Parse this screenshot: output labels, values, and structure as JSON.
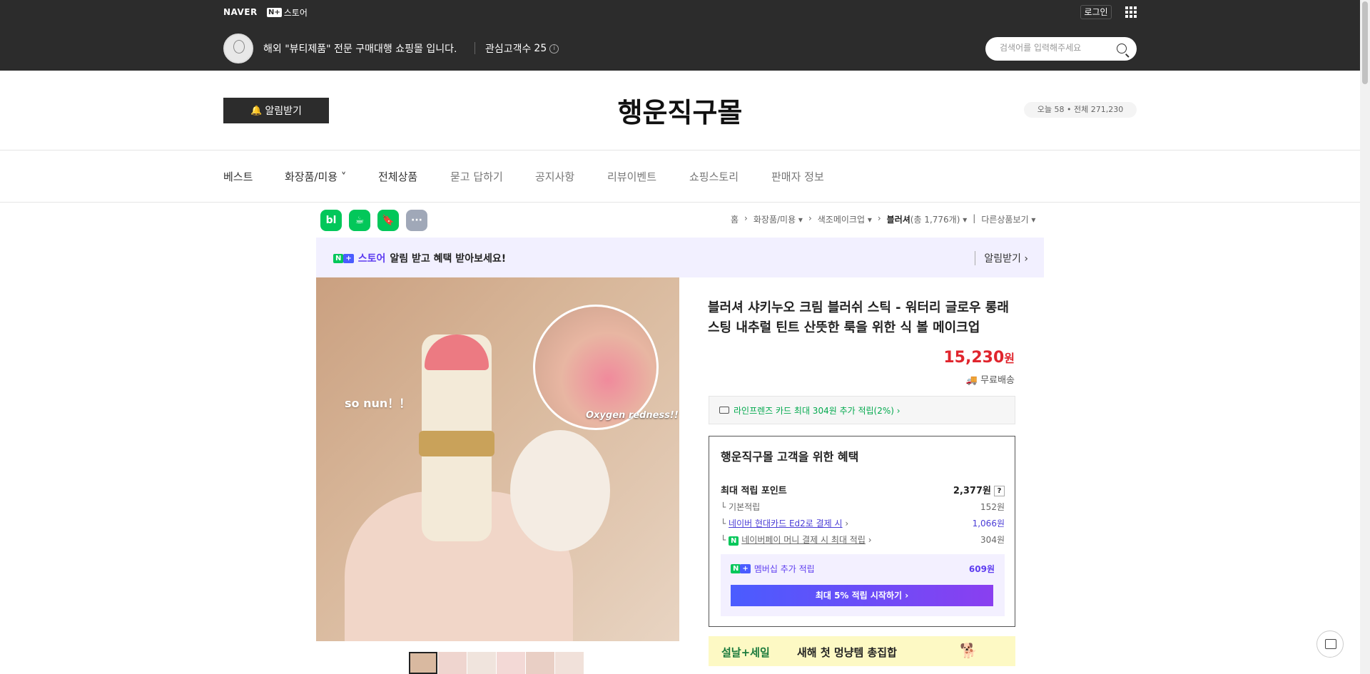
{
  "topbar": {
    "naver_logo": "NAVER",
    "store_brand": "스토어",
    "store_brand_box": "N+",
    "login": "로그인",
    "shop_description": "해외 \"뷰티제품\" 전문 구매대행 쇼핑몰 입니다.",
    "favorites_label": "관심고객수",
    "favorites_count": "25",
    "search_placeholder": "검색어를 입력해주세요"
  },
  "header": {
    "alarm_button": "알림받기",
    "store_title": "행운직구몰",
    "visits": "오늘 58 • 전체 271,230"
  },
  "nav": {
    "items": [
      {
        "label": "베스트"
      },
      {
        "label": "화장품/미용"
      },
      {
        "label": "전체상품"
      },
      {
        "label": "묻고 답하기"
      },
      {
        "label": "공지사항"
      },
      {
        "label": "리뷰이벤트"
      },
      {
        "label": "쇼핑스토리"
      },
      {
        "label": "판매자 정보"
      }
    ]
  },
  "share": {
    "icons": [
      "blog-icon",
      "cafe-icon",
      "bookmark-icon",
      "more-icon"
    ],
    "labels": [
      "bl",
      "☕",
      "🔖",
      "···"
    ],
    "colors": [
      "#03c75a",
      "#03c75a",
      "#03c75a",
      "#a0a8b8"
    ]
  },
  "breadcrumb": {
    "home": "홈",
    "c1": "화장품/미용",
    "c2": "색조메이크업",
    "c3": "블러셔",
    "count": "(총 1,776개)",
    "other": "다른상품보기"
  },
  "notice": {
    "store": "스토어",
    "text": "알림 받고 혜택 받아보세요!",
    "right": "알림받기 ›"
  },
  "image": {
    "overlay_left": "so nun！！",
    "overlay_right": "Oxygen redness!!"
  },
  "product": {
    "title": "블러셔 샤키누오 크림 블러쉬 스틱 - 워터리 글로우 롱래스팅 내추럴 틴트 산뜻한 룩을 위한 식 볼 메이크업",
    "price": "15,230",
    "price_unit": "원",
    "shipping": "무료배송",
    "card_benefit": "라인프렌즈 카드 최대 304원 추가 적립(2%) ›"
  },
  "benefit": {
    "title": "행운직구몰 고객을 위한 혜택",
    "max_points_label": "최대 적립 포인트",
    "max_points_value": "2,377원",
    "base_label": "기본적립",
    "base_value": "152원",
    "card_label": "네이버 현대카드 Ed2로 결제 시",
    "card_value": "1,066원",
    "pay_label": "네이버페이 머니 결제 시 최대 적립",
    "pay_value": "304원",
    "member_label": "멤버십 추가 적립",
    "member_value": "609원",
    "member_button": "최대 5% 적립 시작하기 ›"
  },
  "promo": {
    "tag": "설날+세일",
    "text": "새해 첫 멍냥템 총집합"
  },
  "thumb_colors": [
    "#d9b9a0",
    "#efd5cf",
    "#f0e4dd",
    "#f3d9d6",
    "#e9cfc5",
    "#f1e1da"
  ]
}
